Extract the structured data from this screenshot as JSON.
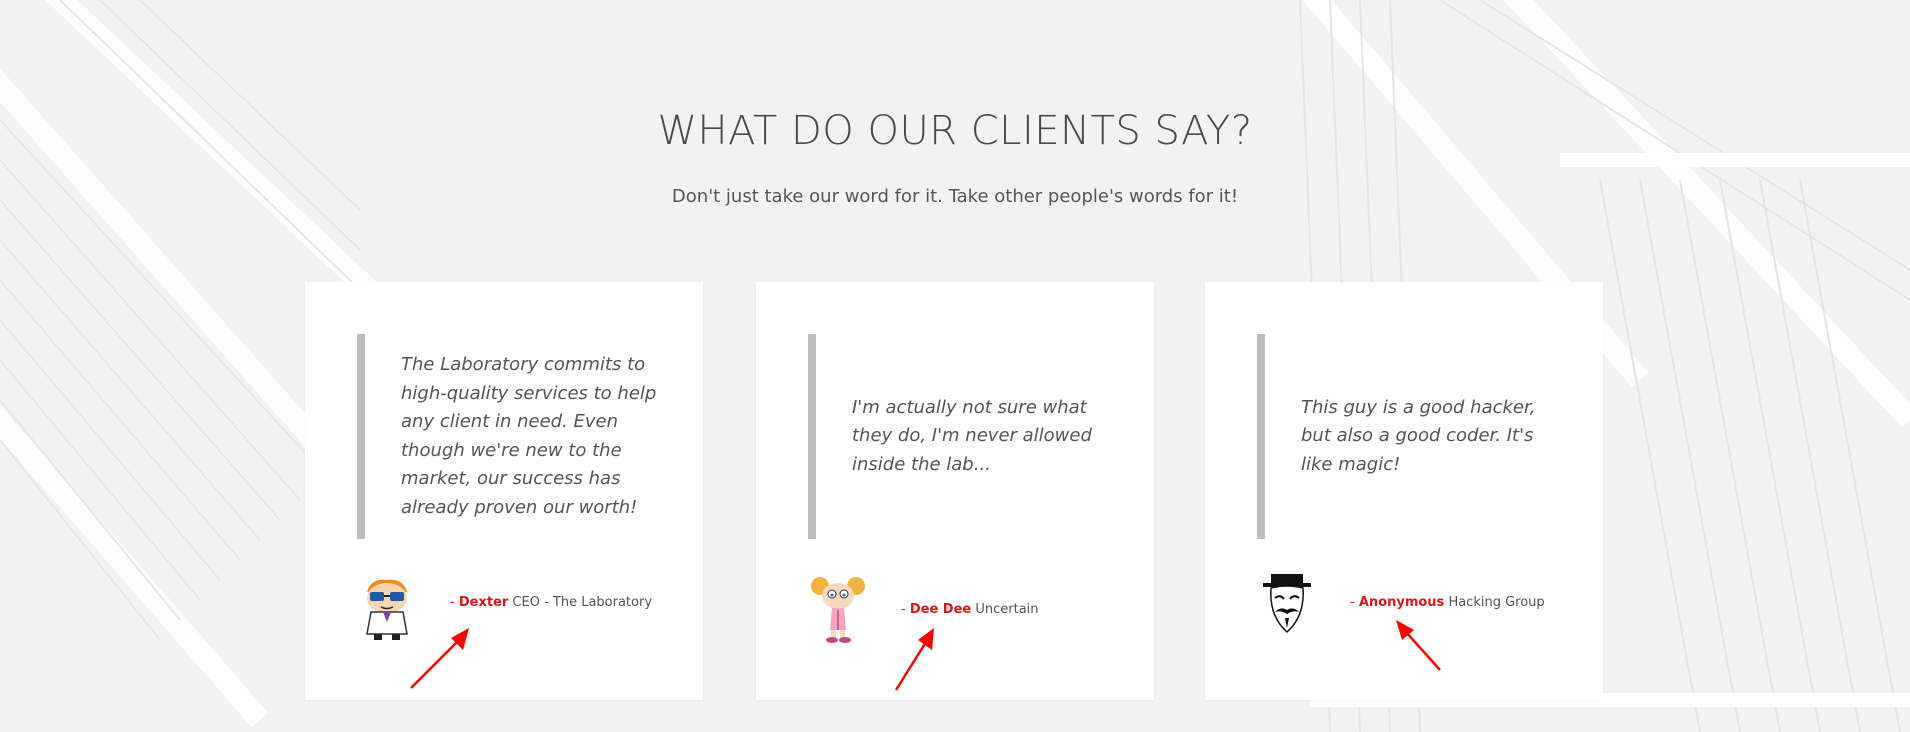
{
  "section": {
    "title": "WHAT DO OUR CLIENTS SAY?",
    "subtitle": "Don't just take our word for it. Take other people's words for it!"
  },
  "testimonials": [
    {
      "quote": "The Laboratory commits to high-quality services to help any client in need. Even though we're new to the market, our success has already proven our worth!",
      "dash": "-",
      "name": "Dexter",
      "role": "CEO - The Laboratory",
      "avatar_icon": "dexter-avatar-icon"
    },
    {
      "quote": "I'm actually not sure what they do, I'm never allowed inside the lab...",
      "dash": "-",
      "name": "Dee Dee",
      "role": "Uncertain",
      "avatar_icon": "dee-dee-avatar-icon"
    },
    {
      "quote": "This guy is a good hacker, but also a good coder. It's like magic!",
      "dash": "-",
      "name": "Anonymous",
      "role": "Hacking Group",
      "avatar_icon": "anonymous-mask-avatar-icon"
    }
  ],
  "colors": {
    "accent": "#e0151b",
    "quote_border": "#bdbdbd",
    "arrow": "#ff0000",
    "text": "#555555",
    "title": "#4a4a4a"
  }
}
